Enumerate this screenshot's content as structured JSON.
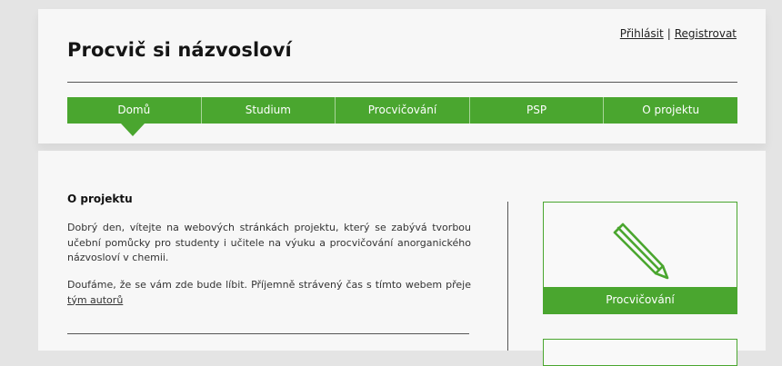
{
  "header": {
    "site_title": "Procvič si názvosloví",
    "login_label": "Přihlásit",
    "separator": "|",
    "register_label": "Registrovat"
  },
  "nav": {
    "items": [
      "Domů",
      "Studium",
      "Procvičování",
      "PSP",
      "O projektu"
    ],
    "active": "Domů"
  },
  "main": {
    "section_title": "O projektu",
    "paragraph1": "Dobrý den, vítejte na webových stránkách projektu, který se zabývá tvorbou učební pomůcky pro studenty i učitele na výuku a procvičování anorganického názvosloví v chemii.",
    "paragraph2_text": "Doufáme, že se vám zde bude líbit. Příjemně strávený čas s tímto webem přeje ",
    "paragraph2_link": "tým autorů"
  },
  "sidebar": {
    "tile_label": "Procvičování",
    "tile_icon": "pencil-icon"
  },
  "colors": {
    "accent": "#4aa62f",
    "background": "#e4e4e4",
    "card": "#f7f7f7"
  }
}
